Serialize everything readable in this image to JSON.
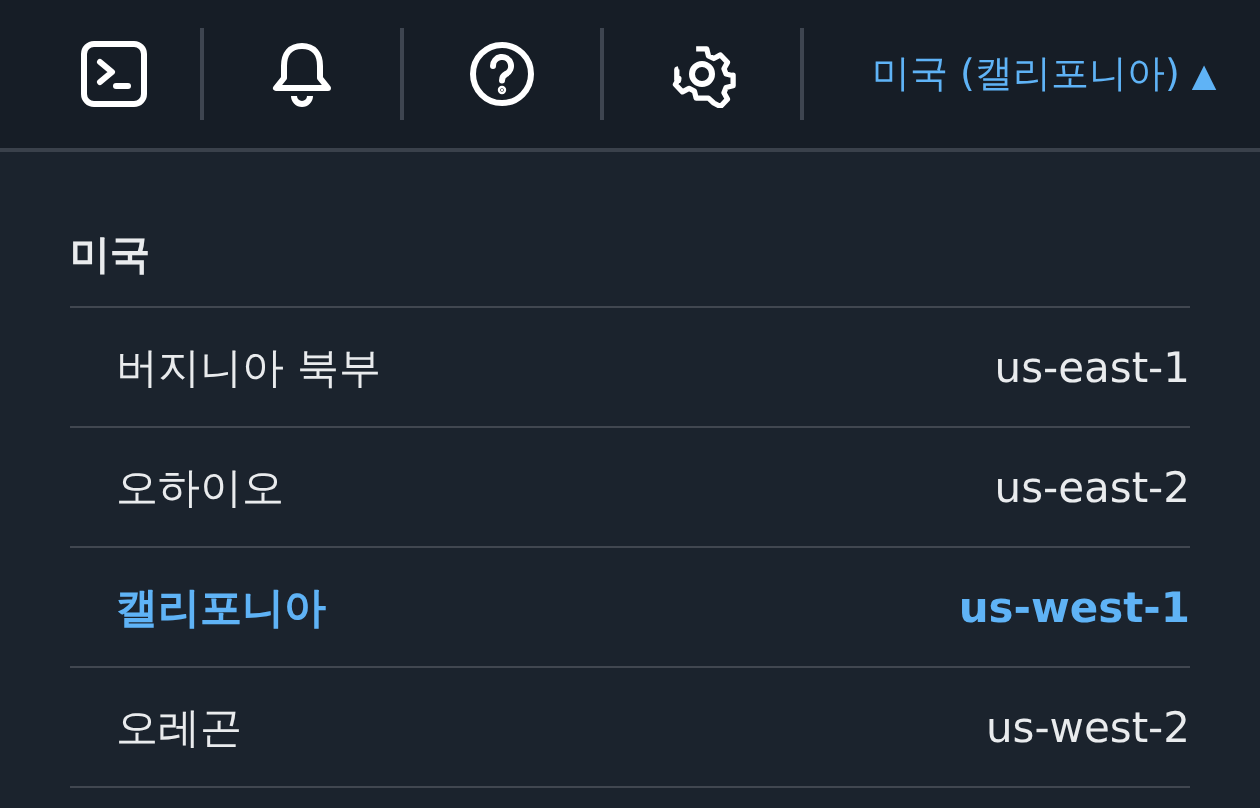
{
  "top_bar": {
    "icons": [
      {
        "kind": "terminal"
      },
      {
        "kind": "bell"
      },
      {
        "kind": "help"
      },
      {
        "kind": "settings"
      }
    ],
    "region_button": {
      "label": "미국 (캘리포니아)",
      "caret": "▲",
      "expanded": true
    }
  },
  "region_menu": {
    "group": "미국",
    "items": [
      {
        "name": "버지니아 북부",
        "code": "us-east-1",
        "selected": false
      },
      {
        "name": "오하이오",
        "code": "us-east-2",
        "selected": false
      },
      {
        "name": "캘리포니아",
        "code": "us-west-1",
        "selected": true
      },
      {
        "name": "오레곤",
        "code": "us-west-2",
        "selected": false
      }
    ]
  }
}
